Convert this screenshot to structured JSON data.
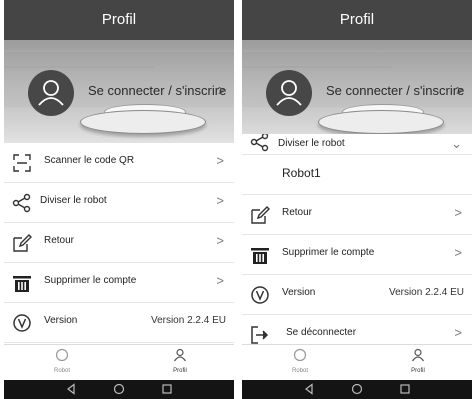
{
  "left": {
    "header_title": "Profil",
    "login_text": "Se connecter / s'inscrire",
    "items": [
      {
        "label": "Scanner le code QR"
      },
      {
        "label": "Diviser le robot"
      },
      {
        "label": "Retour"
      },
      {
        "label": "Supprimer le compte"
      },
      {
        "label": "Version",
        "value": "Version 2.2.4 EU"
      }
    ],
    "tabs": {
      "robot": "Robot",
      "profile": "Profil"
    }
  },
  "right": {
    "header_title": "Profil",
    "login_text": "Se connecter / s'inscrire",
    "partial_item": "Diviser le robot",
    "robot_name": "Robot1",
    "items": [
      {
        "label": "Retour"
      },
      {
        "label": "Supprimer le compte"
      },
      {
        "label": "Version",
        "value": "Version 2.2.4 EU"
      },
      {
        "label": "Se déconnecter"
      }
    ],
    "tabs": {
      "robot": "Robot",
      "profile": "Profil"
    }
  },
  "icons": {
    "chevron": "chevron-right-icon",
    "avatar": "user-avatar-icon",
    "qr": "qr-scan-icon",
    "share": "share-icon",
    "edit": "edit-icon",
    "trash": "trash-icon",
    "version": "version-v-icon",
    "logout": "logout-icon",
    "robot_tab": "robot-tab-icon",
    "profile_tab": "profile-tab-icon"
  },
  "colors": {
    "header": "#454545",
    "navbar": "#141414",
    "avatar": "#474747",
    "text": "#222222"
  }
}
